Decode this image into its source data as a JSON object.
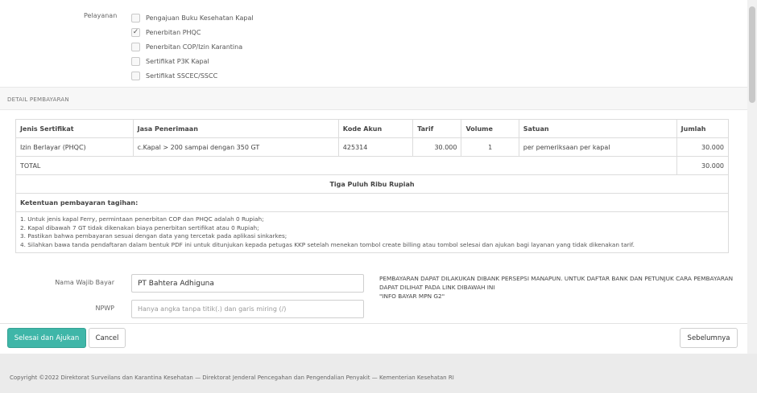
{
  "layanan": {
    "label": "Pelayanan",
    "options": [
      {
        "label": "Pengajuan Buku Kesehatan Kapal",
        "checked": false
      },
      {
        "label": "Penerbitan PHQC",
        "checked": true
      },
      {
        "label": "Penerbitan COP/Izin Karantina",
        "checked": false
      },
      {
        "label": "Sertifikat P3K Kapal",
        "checked": false
      },
      {
        "label": "Sertifikat SSCEC/SSCC",
        "checked": false
      }
    ]
  },
  "detail": {
    "section_title": "DETAIL PEMBAYARAN",
    "headers": [
      "Jenis Sertifikat",
      "Jasa Penerimaan",
      "Kode Akun",
      "Tarif",
      "Volume",
      "Satuan",
      "Jumlah"
    ],
    "row": {
      "jenis": "Izin Berlayar (PHQC)",
      "jasa": "c.Kapal > 200 sampai dengan 350 GT",
      "kode": "425314",
      "tarif": "30.000",
      "volume": "1",
      "satuan": "per pemeriksaan per kapal",
      "jumlah": "30.000"
    },
    "total_label": "TOTAL",
    "total_value": "30.000",
    "terbilang": "Tiga Puluh Ribu Rupiah",
    "ketentuan_title": "Ketentuan pembayaran tagihan:",
    "rules": [
      "1. Untuk jenis kapal Ferry, permintaan penerbitan COP dan PHQC adalah 0 Rupiah;",
      "2. Kapal dibawah 7 GT tidak dikenakan biaya penerbitan sertifikat atau 0 Rupiah;",
      "3. Pastikan bahwa pembayaran sesuai dengan data yang tercetak pada aplikasi sinkarkes;",
      "4. Silahkan bawa tanda pendaftaran dalam bentuk PDF ini untuk ditunjukan kepada petugas KKP setelah menekan tombol create billing atau tombol selesai dan ajukan bagi layanan yang tidak dikenakan tarif."
    ]
  },
  "form": {
    "wajib_bayar_label": "Nama Wajib Bayar",
    "wajib_bayar_value": "PT Bahtera Adhiguna",
    "npwp_label": "NPWP",
    "npwp_placeholder": "Hanya angka tanpa titik(.) dan garis miring (/)"
  },
  "notice": {
    "text": "PEMBAYARAN DAPAT DILAKUKAN DIBANK PERSEPSI MANAPUN. UNTUK DAFTAR BANK DAN PETUNJUK CARA PEMBAYARAN DAPAT DILIHAT PADA LINK DIBAWAH INI",
    "link": "\"INFO BAYAR MPN G2\""
  },
  "buttons": {
    "submit": "Selesai dan Ajukan",
    "cancel": "Cancel",
    "previous": "Sebelumnya"
  },
  "footer": {
    "copyright": "Copyright ©2022 Direktorat Surveilans dan Karantina Kesehatan — Direktorat Jenderal Pencegahan dan Pengendalian Penyakit — Kementerian Kesehatan RI"
  }
}
